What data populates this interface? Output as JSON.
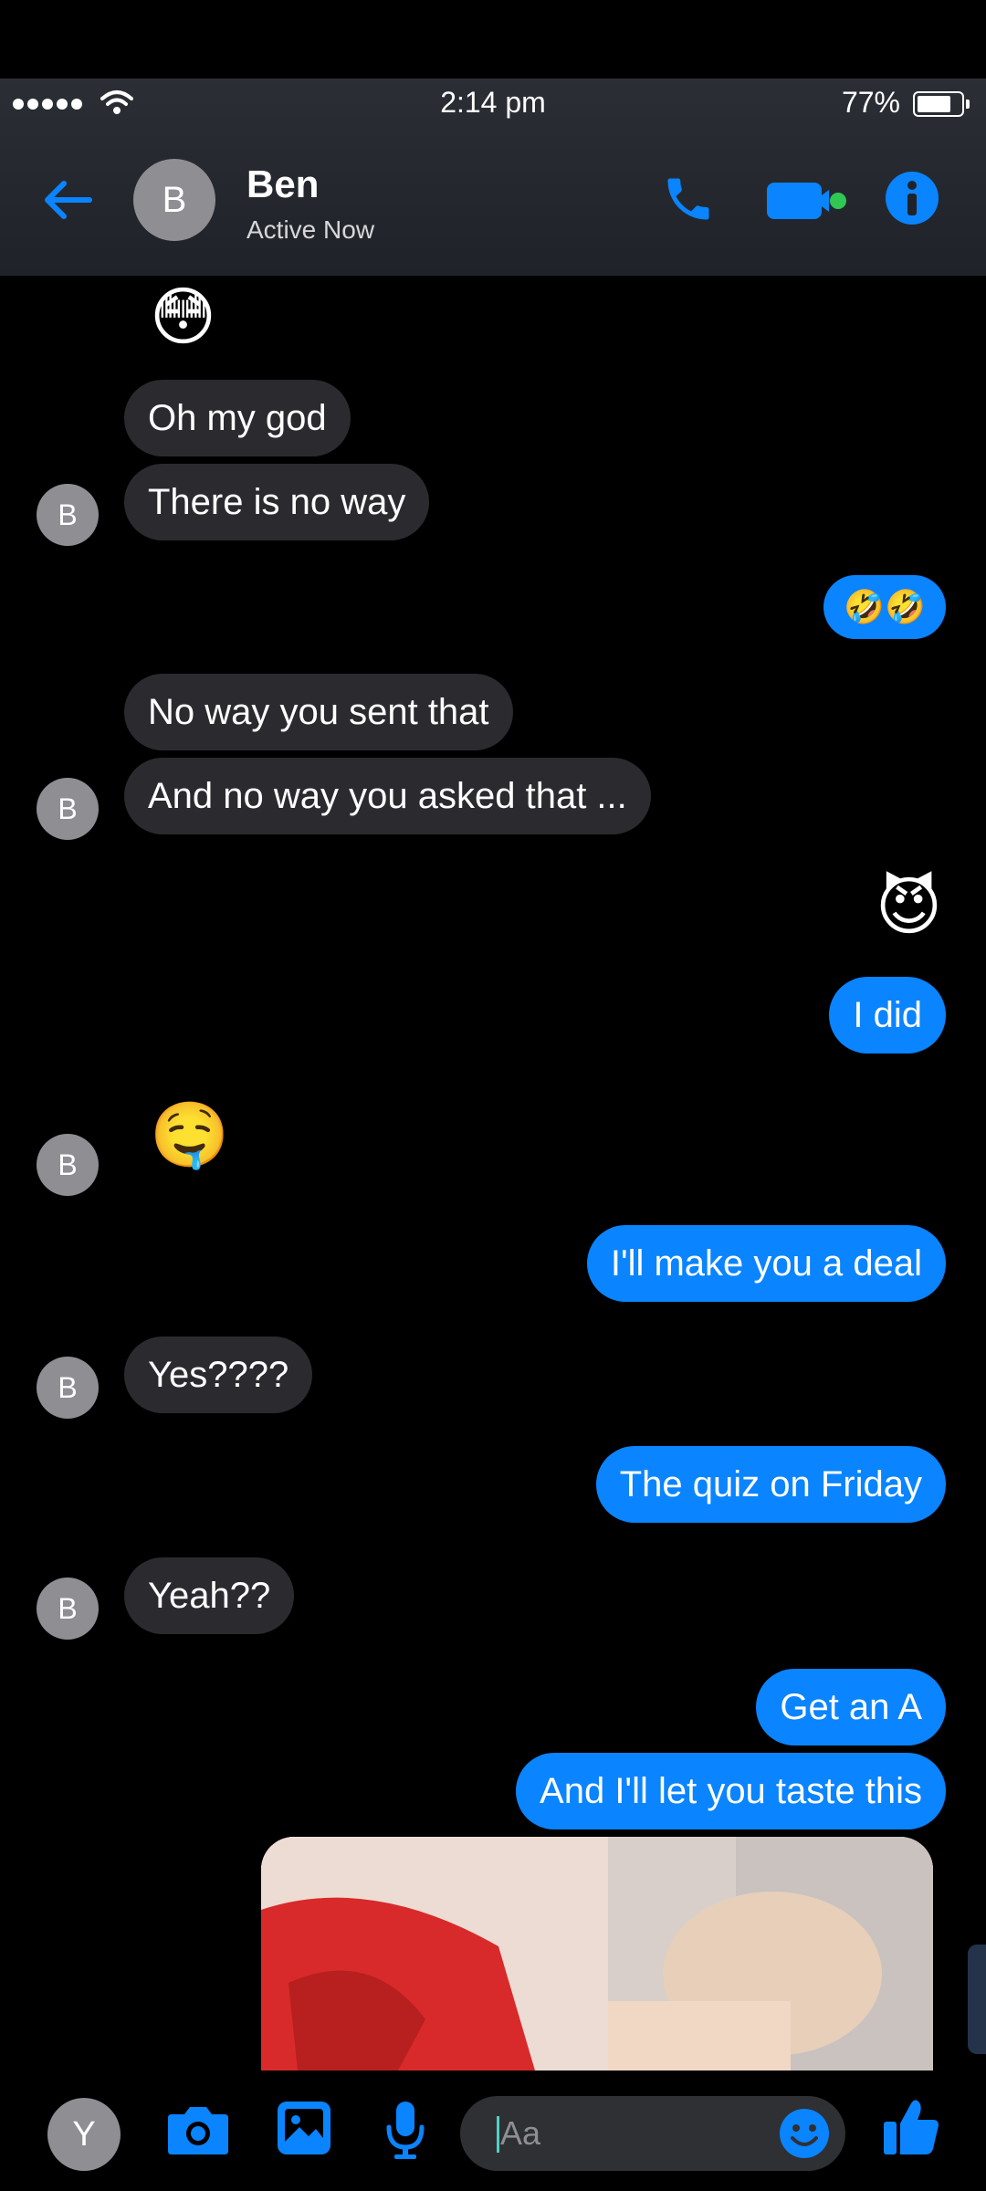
{
  "status": {
    "time": "2:14 pm",
    "battery": "77%",
    "battery_level": 0.77
  },
  "header": {
    "avatar_letter": "B",
    "name": "Ben",
    "status": "Active Now"
  },
  "messages": [
    {
      "side": "in",
      "type": "emoji",
      "text": "😳"
    },
    {
      "side": "in",
      "type": "text",
      "text": "Oh my god"
    },
    {
      "side": "in",
      "type": "text",
      "text": "There is no way",
      "avatar": "B"
    },
    {
      "side": "out",
      "type": "text",
      "text": "🤣🤣"
    },
    {
      "side": "in",
      "type": "text",
      "text": "No way you sent that"
    },
    {
      "side": "in",
      "type": "text",
      "text": "And no way you asked that ...",
      "avatar": "B"
    },
    {
      "side": "out",
      "type": "emoji",
      "text": "😈"
    },
    {
      "side": "out",
      "type": "text",
      "text": "I did"
    },
    {
      "side": "in",
      "type": "emoji",
      "text": "🤤",
      "avatar": "B"
    },
    {
      "side": "out",
      "type": "text",
      "text": "I'll make you a deal"
    },
    {
      "side": "in",
      "type": "text",
      "text": "Yes????",
      "avatar": "B"
    },
    {
      "side": "out",
      "type": "text",
      "text": "The quiz on Friday"
    },
    {
      "side": "in",
      "type": "text",
      "text": "Yeah??",
      "avatar": "B"
    },
    {
      "side": "out",
      "type": "text",
      "text": "Get an A"
    },
    {
      "side": "out",
      "type": "text",
      "text": "And I'll let you taste this"
    },
    {
      "side": "out",
      "type": "image",
      "text": ""
    }
  ],
  "composer": {
    "avatar_letter": "Y",
    "placeholder": "Aa"
  },
  "colors": {
    "accent": "#0a84ff",
    "incoming_bubble": "#2b2b2f",
    "active_dot": "#31c754"
  },
  "icons": [
    "back-arrow-icon",
    "phone-icon",
    "video-icon",
    "info-icon",
    "camera-icon",
    "image-icon",
    "microphone-icon",
    "emoji-icon",
    "thumbs-up-icon"
  ]
}
